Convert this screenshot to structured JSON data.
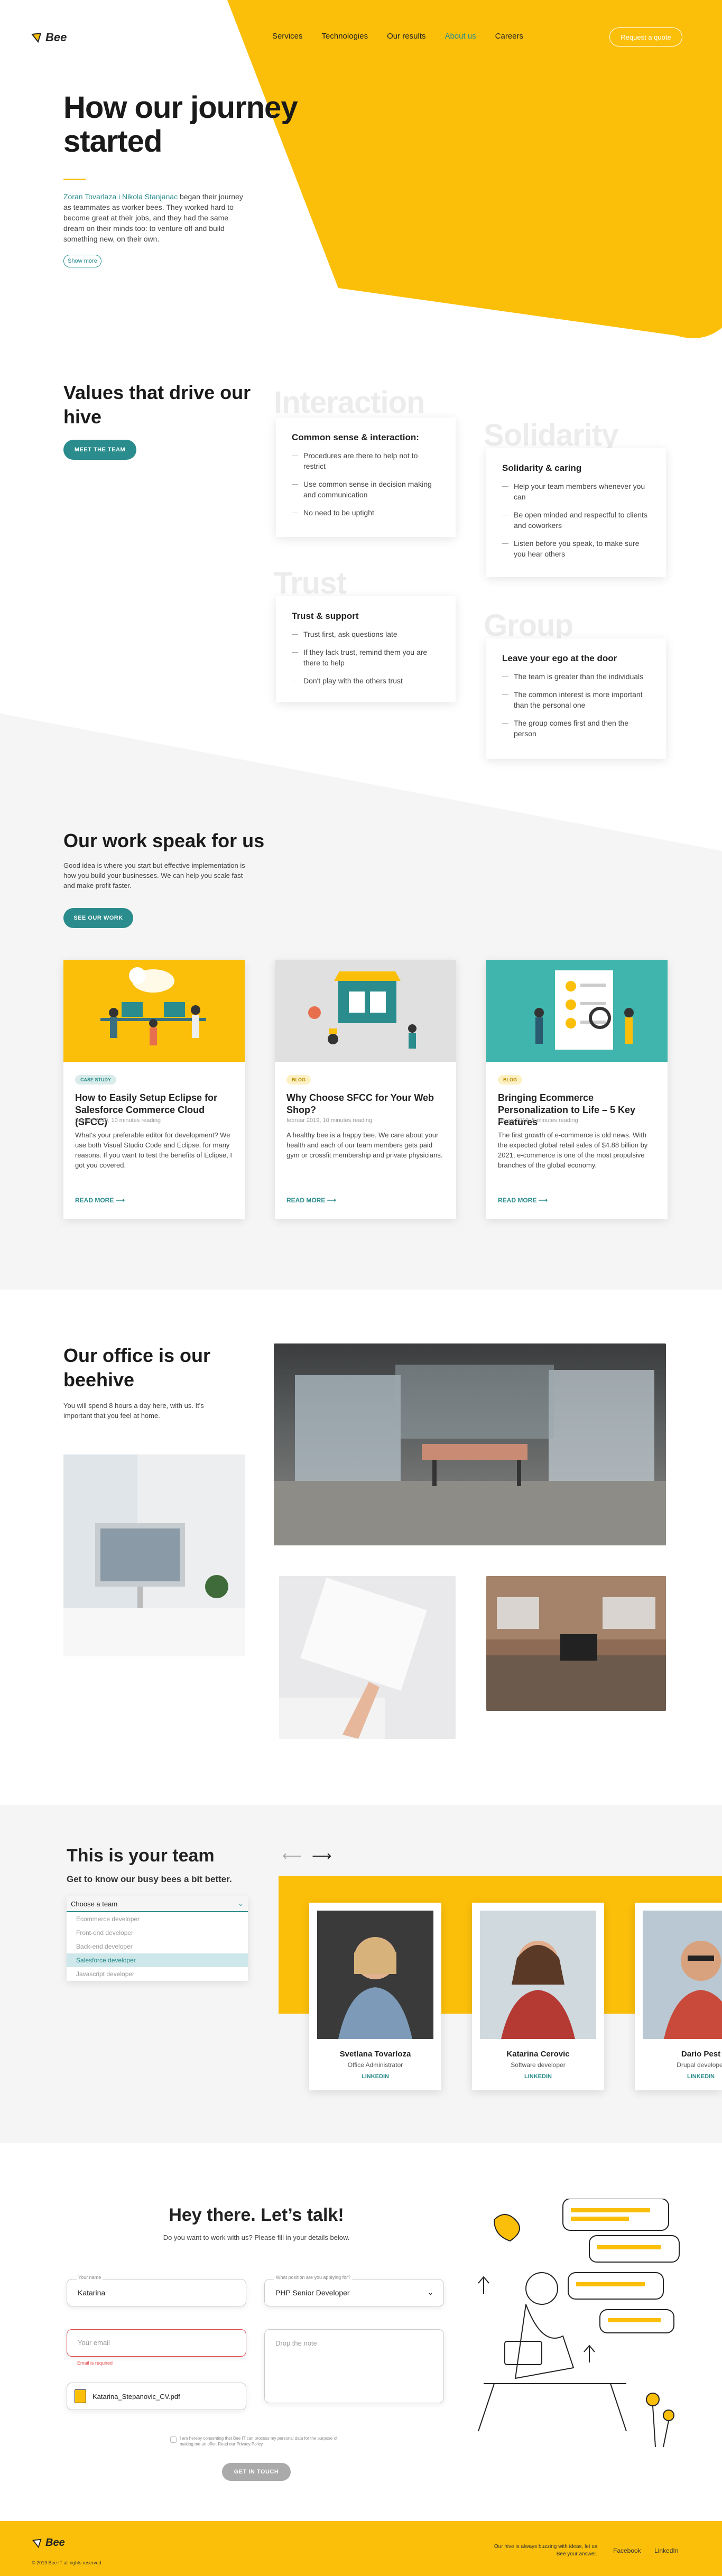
{
  "header": {
    "logo": "Bee",
    "nav": [
      "Services",
      "Technologies",
      "Our results",
      "About us",
      "Careers"
    ],
    "active_nav": "About us",
    "cta": "Request a quote"
  },
  "hero": {
    "title": "How our journey started",
    "founders": "Zoran Tovarlaza i Nikola Stanjanac",
    "text": " began their journey as teammates as worker bees. They worked hard to become great at their jobs, and they had the same dream on their minds too: to venture off and build something new, on their own.",
    "more": "Show more"
  },
  "values": {
    "title": "Values that drive our hive",
    "button": "MEET THE TEAM",
    "cards": [
      {
        "ghost": "Interaction",
        "title": "Common sense & interaction:",
        "items": [
          "Procedures are there to help not to restrict",
          "Use common sense in decision making and communication",
          "No need to be uptight"
        ]
      },
      {
        "ghost": "Solidarity",
        "title": "Solidarity & caring",
        "items": [
          "Help your team members whenever you can",
          "Be open minded and respectful to clients and coworkers",
          "Listen before you speak, to make sure you hear others"
        ]
      },
      {
        "ghost": "Trust",
        "title": "Trust & support",
        "items": [
          "Trust first, ask questions late",
          "If they lack trust, remind them you are there to help",
          "Don't play with the others trust"
        ]
      },
      {
        "ghost": "Group",
        "title": "Leave your ego at the door",
        "items": [
          "The team is greater than the individuals",
          "The common interest is more important than the personal one",
          "The group comes first and then the person"
        ]
      }
    ]
  },
  "work": {
    "title": "Our work speak for us",
    "text": "Good idea is where you start but effective implementation is how you build your businesses.  We can help you scale fast and make profit faster.",
    "button": "SEE OUR WORK",
    "cards": [
      {
        "tag": "CASE STUDY",
        "title": "How to Easily Setup Eclipse for Salesforce Commerce Cloud (SFCC)",
        "meta": "februar 2019, 10 minutes reading",
        "desc": "What's your preferable editor for development? We use both Visual Studio Code and Eclipse, for many reasons. If you want to test the benefits of Eclipse, I got you covered.",
        "more": "READ MORE"
      },
      {
        "tag": "BLOG",
        "title": "Why Choose SFCC for Your Web Shop?",
        "meta": "februar 2019, 10 minutes reading",
        "desc": "A healthy bee is a happy bee. We care about your health and each of our team members gets paid gym or crossfit membership and private physicians.",
        "more": "READ MORE"
      },
      {
        "tag": "BLOG",
        "title": "Bringing Ecommerce Personalization to Life – 5 Key Features",
        "meta": "januar 2019, 5 minutes reading",
        "desc": "The first growth of e-commerce is old news. With the expected global retail sales of $4.88 billion by 2021, e-commerce is one of the most propulsive branches of the global economy.",
        "more": "READ MORE"
      }
    ]
  },
  "office": {
    "title": "Our office is our beehive",
    "text": "You will spend 8 hours a day here, with us. It's important that you feel at home."
  },
  "team": {
    "title": "This is your team",
    "subtitle": "Get to know our busy bees a bit better.",
    "dropdown_label": "Choose a team",
    "options": [
      "Ecommerce developer",
      "Front-end developer",
      "Back-end developer",
      "Salesforce developer",
      "Javascript developer"
    ],
    "selected": "Salesforce developer",
    "members": [
      {
        "name": "Svetlana Tovarloza",
        "role": "Office Administrator",
        "link": "LINKEDIN"
      },
      {
        "name": "Katarina Cerovic",
        "role": "Software developer",
        "link": "LINKEDIN"
      },
      {
        "name": "Dario Pest",
        "role": "Drupal developer",
        "link": "LINKEDIN"
      }
    ]
  },
  "contact": {
    "title": "Hey there. Let’s talk!",
    "subtitle": "Do you want to work with us? Please fill in your details below.",
    "name_label": "Your name",
    "name_value": "Katarina",
    "position_label": "What position are you applying for?",
    "position_value": "PHP Senior Developer",
    "email_placeholder": "Your email",
    "email_error": "Email is required",
    "note_placeholder": "Drop the note",
    "file": "Katarina_Stepanovic_CV.pdf",
    "consent": "I am hereby consenting that Bee IT can process my personal data for the purpose of making me an offer.  Read our Privacy Policy.",
    "submit": "GET IN TOUCH"
  },
  "footer": {
    "logo": "Bee",
    "copyright": "© 2019 Bee IT all rights reserved",
    "tagline": "Our hive is always buzzing with ideas, let us Bee your answer.",
    "links": [
      "Facebook",
      "LinkedIn"
    ]
  },
  "colors": {
    "yellow": "#fbbf0a",
    "teal": "#2a8c8c",
    "gray_band": "#f5f5f5"
  }
}
